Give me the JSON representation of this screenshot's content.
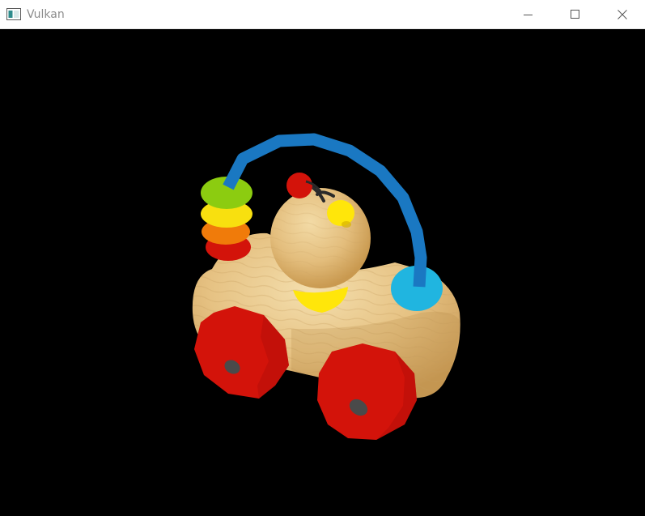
{
  "window": {
    "title": "Vulkan",
    "app_icon": "window-app-icon",
    "controls": [
      "minimize-icon",
      "maximize-icon",
      "close-icon"
    ]
  },
  "scene": {
    "background_color": "#000000",
    "wood_color": "#e9c88b",
    "wheel_color": "#d3130a",
    "hub_color": "#4a4a4a",
    "wire_color": "#1a78c2",
    "ring_colors": [
      "#8ccc10",
      "#f8e00f",
      "#f07b0a",
      "#d3130a"
    ],
    "wire_base_color": "#20b5e0",
    "collar_color": "#ffe60a"
  }
}
